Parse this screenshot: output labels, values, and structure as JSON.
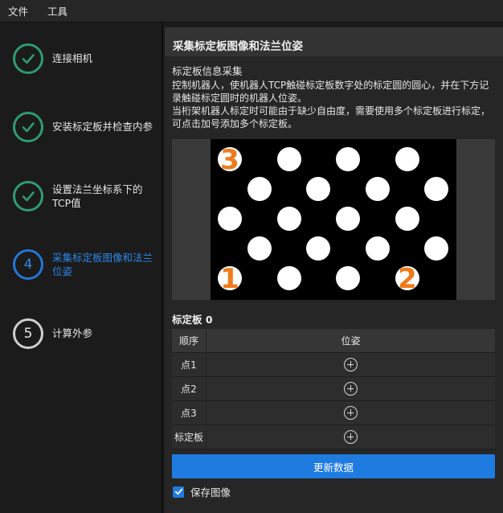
{
  "menu": {
    "items": [
      "文件",
      "工具"
    ]
  },
  "sidebar": {
    "steps": [
      {
        "state": "done",
        "number": "",
        "label": "连接相机"
      },
      {
        "state": "done",
        "number": "",
        "label": "安装标定板并检查内参"
      },
      {
        "state": "done",
        "number": "",
        "label": "设置法兰坐标系下的TCP值"
      },
      {
        "state": "active",
        "number": "4",
        "label": "采集标定板图像和法兰位姿"
      },
      {
        "state": "pending",
        "number": "5",
        "label": "计算外参"
      }
    ]
  },
  "panel": {
    "title": "采集标定板图像和法兰位姿",
    "section_label": "标定板信息采集",
    "instructions": [
      "控制机器人，使机器人TCP触碰标定板数字处的标定圆的圆心，并在下方记录触碰标定圆时的机器人位姿。",
      "当桁架机器人标定时可能由于缺少自由度，需要使用多个标定板进行标定，可点击加号添加多个标定板。"
    ],
    "board_image": {
      "marker_labels": [
        "3",
        "1",
        "2"
      ],
      "marker_color": "#f07a1a"
    },
    "table": {
      "title": "标定板 0",
      "header": {
        "index": "顺序",
        "pose": "位姿"
      },
      "rows": [
        {
          "index": "点1"
        },
        {
          "index": "点2"
        },
        {
          "index": "点3"
        },
        {
          "index": "标定板"
        }
      ]
    },
    "update_button": "更新数据",
    "save_image": {
      "label": "保存图像",
      "checked": true
    }
  },
  "colors": {
    "accent": "#1f7be0",
    "done": "#2f9c72",
    "active": "#2476d6",
    "marker": "#f07a1a"
  }
}
